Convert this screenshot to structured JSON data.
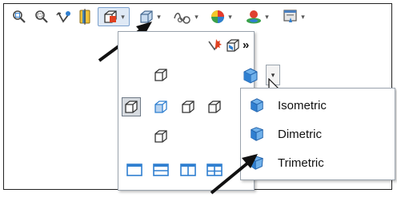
{
  "toolbar": {
    "icons": [
      "zoom-to-fit-icon",
      "zoom-to-area-icon",
      "previous-view-icon",
      "section-view-icon",
      "view-orientation-icon",
      "display-style-icon",
      "hide-show-items-icon",
      "edit-appearance-icon",
      "apply-scene-icon",
      "view-settings-icon"
    ]
  },
  "flyout": {
    "more_label": "»"
  },
  "view_menu": {
    "items": [
      {
        "label": "Isometric"
      },
      {
        "label": "Dimetric"
      },
      {
        "label": "Trimetric"
      }
    ]
  },
  "colors": {
    "cube_blue": "#2f7fd0",
    "pressed_bg": "#dfe9f5",
    "arrow": "#111111"
  }
}
